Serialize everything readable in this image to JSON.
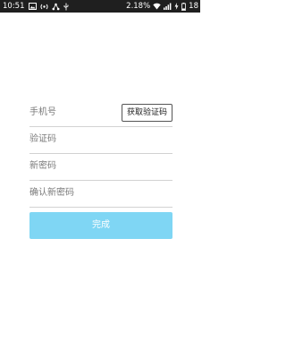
{
  "status_bar": {
    "time": "10:51",
    "network_speed": "2.18",
    "network_unit": "%",
    "battery": "18",
    "icons_left": [
      "image-icon",
      "broadcast-icon",
      "share-icon",
      "usb-icon"
    ],
    "icons_right": [
      "wifi-icon",
      "signal-icon",
      "charging-icon",
      "battery-icon"
    ]
  },
  "form": {
    "phone_placeholder": "手机号",
    "get_code_label": "获取验证码",
    "code_placeholder": "验证码",
    "new_password_placeholder": "新密码",
    "confirm_password_placeholder": "确认新密码"
  },
  "done_label": "完成",
  "colors": {
    "status_bar_bg": "#1f1f1f",
    "primary_button": "#7fd6f4",
    "divider": "#d2d2d2"
  }
}
